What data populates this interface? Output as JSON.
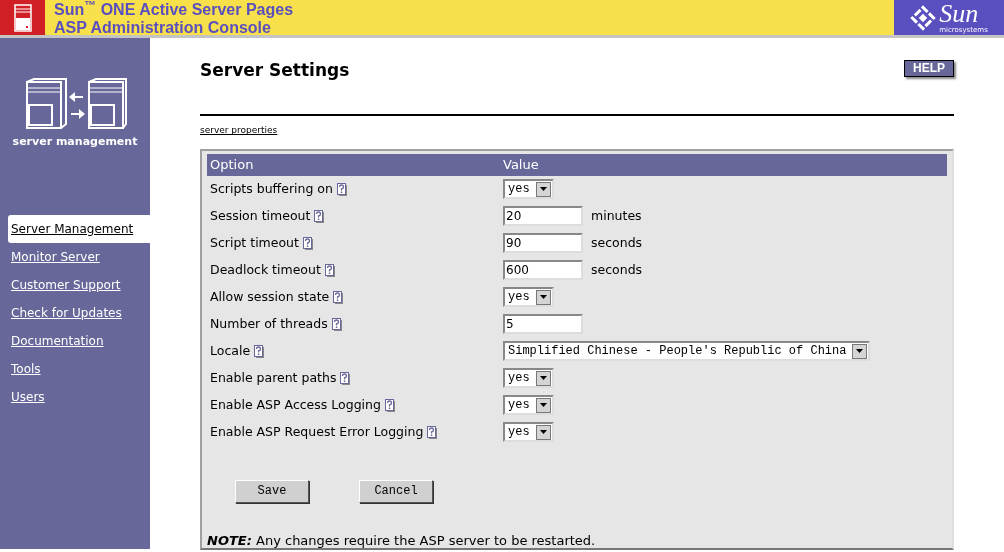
{
  "header": {
    "title_lines": [
      "Sun$^{™}$ ONE Active Server Pages",
      "ASP Administration Console"
    ],
    "logo_word": "Sun",
    "logo_sub": "microsystems"
  },
  "sidebar": {
    "caption": "server management",
    "items": [
      {
        "label": "Server Management",
        "selected": true
      },
      {
        "label": "Monitor Server",
        "selected": false
      },
      {
        "label": "Customer Support",
        "selected": false
      },
      {
        "label": "Check for Updates",
        "selected": false
      },
      {
        "label": "Documentation",
        "selected": false
      },
      {
        "label": "Tools",
        "selected": false
      },
      {
        "label": "Users",
        "selected": false
      }
    ]
  },
  "page": {
    "title": "Server Settings",
    "help_button": "HELP",
    "breadcrumb_link": "server properties"
  },
  "table": {
    "columns": [
      "Option",
      "Value"
    ],
    "rows": [
      {
        "label": "Scripts buffering on",
        "kind": "select",
        "value": "yes"
      },
      {
        "label": "Session timeout",
        "kind": "text",
        "value": "20",
        "unit": "minutes"
      },
      {
        "label": "Script timeout",
        "kind": "text",
        "value": "90",
        "unit": "seconds"
      },
      {
        "label": "Deadlock timeout",
        "kind": "text",
        "value": "600",
        "unit": "seconds"
      },
      {
        "label": "Allow session state",
        "kind": "select",
        "value": "yes"
      },
      {
        "label": "Number of threads",
        "kind": "text",
        "value": "5"
      },
      {
        "label": "Locale",
        "kind": "select",
        "value": "Simplified Chinese - People's Republic of China"
      },
      {
        "label": "Enable parent paths",
        "kind": "select",
        "value": "yes"
      },
      {
        "label": "Enable ASP Access Logging",
        "kind": "select",
        "value": "yes"
      },
      {
        "label": "Enable ASP Request Error Logging",
        "kind": "select",
        "value": "yes"
      }
    ]
  },
  "buttons": [
    "Save",
    "Cancel"
  ],
  "note": "*NOTE:* Any changes require the ASP server to be restarted."
}
